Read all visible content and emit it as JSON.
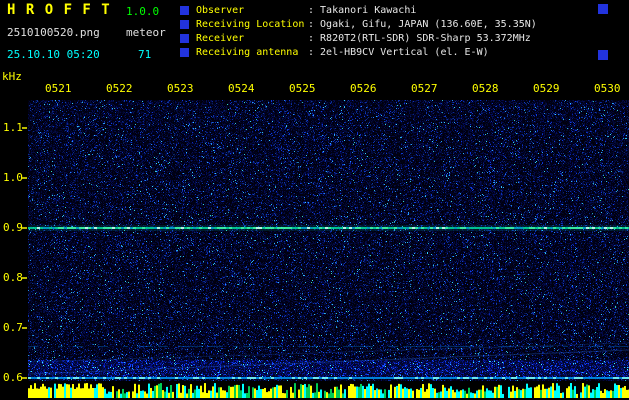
{
  "app": {
    "title": "H R O F F T",
    "version": "1.0.0",
    "filename": "2510100520.png",
    "mode": "meteor",
    "datetime": "25.10.10 05:20",
    "echo_count": "71"
  },
  "info": {
    "separator": ":",
    "rows": [
      {
        "label": "Observer",
        "value": "Takanori Kawachi"
      },
      {
        "label": "Receiving Location",
        "value": "Ogaki, Gifu, JAPAN (136.60E, 35.35N)"
      },
      {
        "label": "Receiver",
        "value": "R820T2(RTL-SDR) SDR-Sharp 53.372MHz"
      },
      {
        "label": "Receiving antenna",
        "value": "2el-HB9CV Vertical (el. E-W)"
      }
    ]
  },
  "chart_data": {
    "type": "heatmap",
    "description": "10-minute radio meteor spectrogram (waterfall): frequency vs time over blue noise background, with continuous carrier line at 0.9 kHz, faint line near 0.66 kHz, brighter noise band just above 0.6 kHz baseline, and a yellow/cyan signal-level bar strip along the bottom edge",
    "ylabel": "kHz",
    "x_tick_labels": [
      "0521",
      "0522",
      "0523",
      "0524",
      "0525",
      "0526",
      "0527",
      "0528",
      "0529",
      "0530"
    ],
    "y_tick_labels": [
      "1.1",
      "1.0",
      "0.9",
      "0.8",
      "0.7",
      "0.6"
    ],
    "y_range_khz": [
      0.6,
      1.15
    ],
    "carrier_line_khz": 0.9,
    "faint_line_khz": 0.66,
    "noise_band_khz": [
      0.61,
      0.64
    ],
    "baseline_khz": 0.6,
    "grid": false,
    "legend": false,
    "colors": {
      "axis_text": "#ffff00",
      "noise_dark": "#000010",
      "noise_blue": "#0030c0",
      "speck_cyan": "#00d0ff",
      "carrier_green": "#40ffa0",
      "bar_yellow": "#ffff00",
      "bar_cyan": "#00ffff",
      "bar_green": "#00cc55"
    }
  }
}
